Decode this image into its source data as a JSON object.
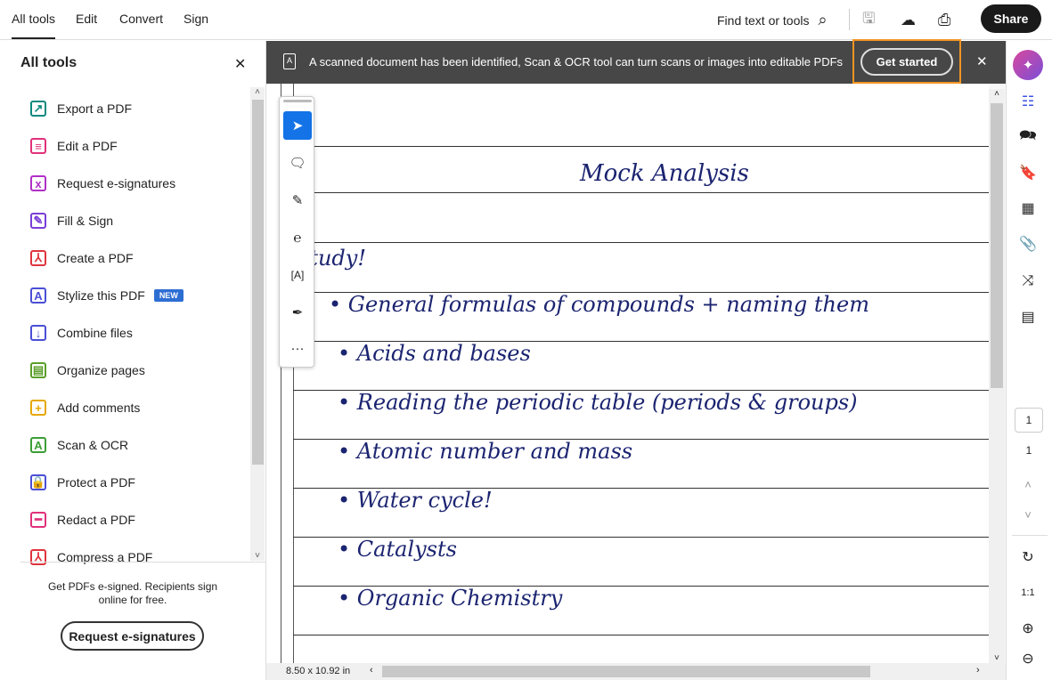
{
  "topbar": {
    "tabs": [
      "All tools",
      "Edit",
      "Convert",
      "Sign"
    ],
    "search_label": "Find text or tools",
    "share": "Share"
  },
  "left_panel": {
    "title": "All tools",
    "items": [
      {
        "label": "Export a PDF",
        "color": "#0d8a7e",
        "glyph": "↗"
      },
      {
        "label": "Edit a PDF",
        "color": "#e0317a",
        "glyph": "≡"
      },
      {
        "label": "Request e-signatures",
        "color": "#b12fc7",
        "glyph": "x"
      },
      {
        "label": "Fill & Sign",
        "color": "#7a3ed6",
        "glyph": "✎"
      },
      {
        "label": "Create a PDF",
        "color": "#e0343e",
        "glyph": "⅄"
      },
      {
        "label": "Stylize this PDF",
        "color": "#4b4fd6",
        "glyph": "A",
        "badge": "NEW"
      },
      {
        "label": "Combine files",
        "color": "#4b4fd6",
        "glyph": "↓"
      },
      {
        "label": "Organize pages",
        "color": "#5a9e2a",
        "glyph": "▤"
      },
      {
        "label": "Add comments",
        "color": "#e6a700",
        "glyph": "+"
      },
      {
        "label": "Scan & OCR",
        "color": "#3c9e34",
        "glyph": "A"
      },
      {
        "label": "Protect a PDF",
        "color": "#4b4fd6",
        "glyph": "🔒"
      },
      {
        "label": "Redact a PDF",
        "color": "#e0317a",
        "glyph": "━"
      },
      {
        "label": "Compress a PDF",
        "color": "#e0343e",
        "glyph": "⅄"
      }
    ],
    "promo_line1": "Get PDFs e-signed. Recipients sign",
    "promo_line2": "online for free.",
    "promo_button": "Request e-signatures"
  },
  "banner": {
    "text": "A scanned document has been identified, Scan & OCR tool can turn scans or images into editable PDFs",
    "button": "Get started",
    "highlight_color": "#f29423"
  },
  "document": {
    "title": "Mock Analysis",
    "lines": [
      "study!",
      "General formulas of compounds + naming them",
      "Acids and bases",
      "Reading the periodic table (periods & groups)",
      "Atomic number and mass",
      "Water cycle!",
      "Catalysts",
      "Organic Chemistry"
    ],
    "page_size": "8.50 x 10.92 in"
  },
  "rail": {
    "page_input": "1",
    "page_total": "1"
  }
}
